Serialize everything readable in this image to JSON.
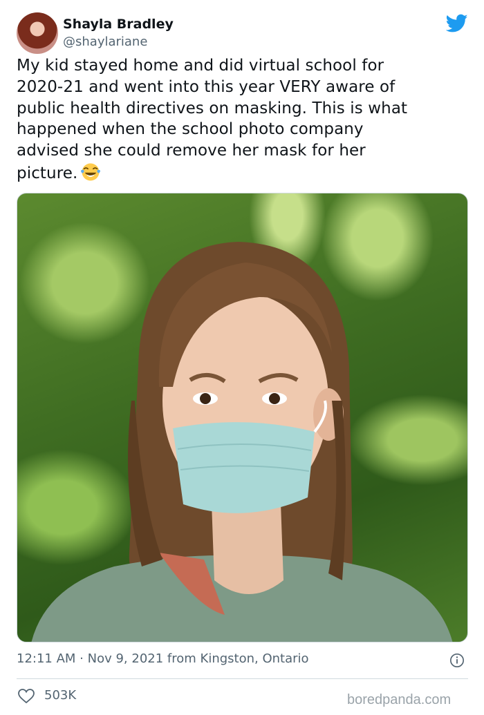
{
  "tweet": {
    "author_name": "Shayla Bradley",
    "author_handle": "@shaylariane",
    "text": "My kid stayed home and did virtual school for\n2020-21 and went into this year VERY aware of\npublic health directives on masking. This is what\nhappened when the school photo company\nadvised she could remove her mask for her\npicture.",
    "emoji_icon": "tears-of-joy-emoji-icon",
    "time": "12:11 AM",
    "separator": " · ",
    "date": "Nov 9, 2021",
    "location": " from Kingston, Ontario",
    "likes": "503K"
  },
  "brand": {
    "twitter_color": "#1d9bf0",
    "watermark": "boredpanda.com"
  }
}
